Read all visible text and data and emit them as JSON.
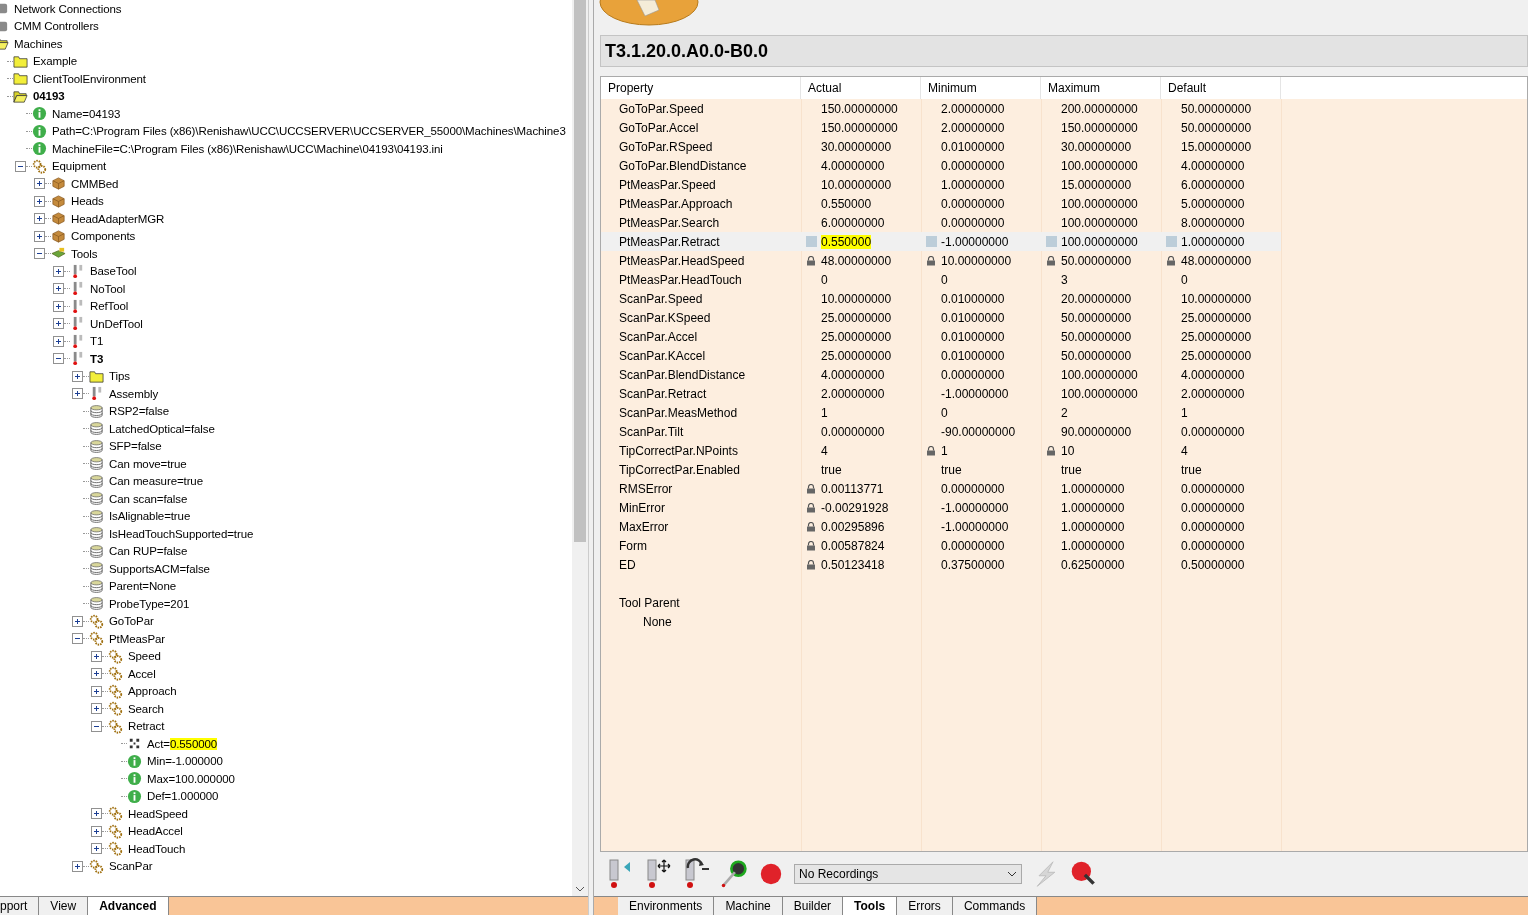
{
  "tree": [
    {
      "label": "Network Connections",
      "kind": "drive"
    },
    {
      "label": "CMM Controllers",
      "kind": "drive"
    },
    {
      "label": "Machines",
      "kind": "folder-open",
      "children": [
        {
          "label": "Example",
          "kind": "folder"
        },
        {
          "label": "ClientToolEnvironment",
          "kind": "folder"
        },
        {
          "label": "04193",
          "kind": "folder-open",
          "active": true,
          "children": [
            {
              "label": "Name=04193",
              "kind": "info"
            },
            {
              "label": "Path=C:\\Program Files (x86)\\Renishaw\\UCC\\UCCSERVER\\UCCSERVER_55000\\Machines\\Machine3",
              "kind": "info"
            },
            {
              "label": "MachineFile=C:\\Program Files (x86)\\Renishaw\\UCC\\Machine\\04193\\04193.ini",
              "kind": "info"
            },
            {
              "label": "Equipment",
              "kind": "gears",
              "expanded": true,
              "children": [
                {
                  "label": "CMMBed",
                  "kind": "box",
                  "expanded": false
                },
                {
                  "label": "Heads",
                  "kind": "box",
                  "expanded": false
                },
                {
                  "label": "HeadAdapterMGR",
                  "kind": "box",
                  "expanded": false
                },
                {
                  "label": "Components",
                  "kind": "box",
                  "expanded": false
                },
                {
                  "label": "Tools",
                  "kind": "tools",
                  "expanded": true,
                  "children": [
                    {
                      "label": "BaseTool",
                      "kind": "probe",
                      "expanded": false
                    },
                    {
                      "label": "NoTool",
                      "kind": "probe",
                      "expanded": false
                    },
                    {
                      "label": "RefTool",
                      "kind": "probe",
                      "expanded": false
                    },
                    {
                      "label": "UnDefTool",
                      "kind": "probe",
                      "expanded": false
                    },
                    {
                      "label": "T1",
                      "kind": "probe",
                      "expanded": false
                    },
                    {
                      "label": "T3",
                      "kind": "probe",
                      "expanded": true,
                      "active": true,
                      "children": [
                        {
                          "label": "Tips",
                          "kind": "folder",
                          "expanded": false
                        },
                        {
                          "label": "Assembly",
                          "kind": "probe",
                          "expanded": false
                        },
                        {
                          "label": "RSP2=false",
                          "kind": "stack"
                        },
                        {
                          "label": "LatchedOptical=false",
                          "kind": "stack"
                        },
                        {
                          "label": "SFP=false",
                          "kind": "stack"
                        },
                        {
                          "label": "Can move=true",
                          "kind": "stack"
                        },
                        {
                          "label": "Can measure=true",
                          "kind": "stack"
                        },
                        {
                          "label": "Can scan=false",
                          "kind": "stack"
                        },
                        {
                          "label": "IsAlignable=true",
                          "kind": "stack"
                        },
                        {
                          "label": "IsHeadTouchSupported=true",
                          "kind": "stack"
                        },
                        {
                          "label": "Can RUP=false",
                          "kind": "stack"
                        },
                        {
                          "label": "SupportsACM=false",
                          "kind": "stack"
                        },
                        {
                          "label": "Parent=None",
                          "kind": "stack"
                        },
                        {
                          "label": "ProbeType=201",
                          "kind": "stack"
                        },
                        {
                          "label": "GoToPar",
                          "kind": "gears",
                          "expanded": false
                        },
                        {
                          "label": "PtMeasPar",
                          "kind": "gears",
                          "expanded": true,
                          "children": [
                            {
                              "label": "Speed",
                              "kind": "gears",
                              "expanded": false
                            },
                            {
                              "label": "Accel",
                              "kind": "gears",
                              "expanded": false
                            },
                            {
                              "label": "Approach",
                              "kind": "gears",
                              "expanded": false
                            },
                            {
                              "label": "Search",
                              "kind": "gears",
                              "expanded": false
                            },
                            {
                              "label": "Retract",
                              "kind": "gears",
                              "expanded": true,
                              "children": [
                                {
                                  "label": "Act=",
                                  "value": "0.550000",
                                  "highlighted": true,
                                  "kind": "grid"
                                },
                                {
                                  "label": "Min=-1.000000",
                                  "kind": "info"
                                },
                                {
                                  "label": "Max=100.000000",
                                  "kind": "info"
                                },
                                {
                                  "label": "Def=1.000000",
                                  "kind": "info"
                                }
                              ]
                            },
                            {
                              "label": "HeadSpeed",
                              "kind": "gears",
                              "expanded": false
                            },
                            {
                              "label": "HeadAccel",
                              "kind": "gears",
                              "expanded": false
                            },
                            {
                              "label": "HeadTouch",
                              "kind": "gears",
                              "expanded": false
                            }
                          ]
                        },
                        {
                          "label": "ScanPar",
                          "kind": "gears",
                          "expanded": false
                        }
                      ]
                    }
                  ]
                }
              ]
            }
          ]
        }
      ]
    }
  ],
  "left_tabs": [
    {
      "label": "pport",
      "selected": false
    },
    {
      "label": "View",
      "selected": false
    },
    {
      "label": "Advanced",
      "selected": true
    }
  ],
  "title": "T3.1.20.0.A0.0-B0.0",
  "table": {
    "columns": [
      "Property",
      "Actual",
      "Minimum",
      "Maximum",
      "Default"
    ],
    "rows": [
      {
        "selected": false,
        "cells": [
          {
            "text": "GoToPar.Speed"
          },
          {
            "text": "150.00000000"
          },
          {
            "text": "2.00000000"
          },
          {
            "text": "200.00000000"
          },
          {
            "text": "50.00000000"
          }
        ]
      },
      {
        "selected": false,
        "cells": [
          {
            "text": "GoToPar.Accel"
          },
          {
            "text": "150.00000000"
          },
          {
            "text": "2.00000000"
          },
          {
            "text": "150.00000000"
          },
          {
            "text": "50.00000000"
          }
        ]
      },
      {
        "selected": false,
        "cells": [
          {
            "text": "GoToPar.RSpeed"
          },
          {
            "text": "30.00000000"
          },
          {
            "text": "0.01000000"
          },
          {
            "text": "30.00000000"
          },
          {
            "text": "15.00000000"
          }
        ]
      },
      {
        "selected": false,
        "cells": [
          {
            "text": "GoToPar.BlendDistance"
          },
          {
            "text": "4.00000000"
          },
          {
            "text": "0.00000000"
          },
          {
            "text": "100.00000000"
          },
          {
            "text": "4.00000000"
          }
        ]
      },
      {
        "selected": false,
        "cells": [
          {
            "text": "PtMeasPar.Speed"
          },
          {
            "text": "10.00000000"
          },
          {
            "text": "1.00000000"
          },
          {
            "text": "15.00000000"
          },
          {
            "text": "6.00000000"
          }
        ]
      },
      {
        "selected": false,
        "cells": [
          {
            "text": "PtMeasPar.Approach"
          },
          {
            "text": "0.550000"
          },
          {
            "text": "0.00000000"
          },
          {
            "text": "100.00000000"
          },
          {
            "text": "5.00000000"
          }
        ]
      },
      {
        "selected": false,
        "cells": [
          {
            "text": "PtMeasPar.Search"
          },
          {
            "text": "6.00000000"
          },
          {
            "text": "0.00000000"
          },
          {
            "text": "100.00000000"
          },
          {
            "text": "8.00000000"
          }
        ]
      },
      {
        "selected": true,
        "cells": [
          {
            "text": "PtMeasPar.Retract"
          },
          {
            "text": "0.550000",
            "kind": "square",
            "highlighted": true
          },
          {
            "text": "-1.00000000",
            "kind": "square"
          },
          {
            "text": "100.00000000",
            "kind": "square"
          },
          {
            "text": "1.00000000",
            "kind": "square"
          }
        ]
      },
      {
        "selected": false,
        "cells": [
          {
            "text": "PtMeasPar.HeadSpeed"
          },
          {
            "text": "48.00000000",
            "kind": "lock"
          },
          {
            "text": "10.00000000",
            "kind": "lock"
          },
          {
            "text": "50.00000000",
            "kind": "lock"
          },
          {
            "text": "48.00000000",
            "kind": "lock"
          }
        ]
      },
      {
        "selected": false,
        "cells": [
          {
            "text": "PtMeasPar.HeadTouch"
          },
          {
            "text": "0"
          },
          {
            "text": "0"
          },
          {
            "text": "3"
          },
          {
            "text": "0"
          }
        ]
      },
      {
        "selected": false,
        "cells": [
          {
            "text": "ScanPar.Speed"
          },
          {
            "text": "10.00000000"
          },
          {
            "text": "0.01000000"
          },
          {
            "text": "20.00000000"
          },
          {
            "text": "10.00000000"
          }
        ]
      },
      {
        "selected": false,
        "cells": [
          {
            "text": "ScanPar.KSpeed"
          },
          {
            "text": "25.00000000"
          },
          {
            "text": "0.01000000"
          },
          {
            "text": "50.00000000"
          },
          {
            "text": "25.00000000"
          }
        ]
      },
      {
        "selected": false,
        "cells": [
          {
            "text": "ScanPar.Accel"
          },
          {
            "text": "25.00000000"
          },
          {
            "text": "0.01000000"
          },
          {
            "text": "50.00000000"
          },
          {
            "text": "25.00000000"
          }
        ]
      },
      {
        "selected": false,
        "cells": [
          {
            "text": "ScanPar.KAccel"
          },
          {
            "text": "25.00000000"
          },
          {
            "text": "0.01000000"
          },
          {
            "text": "50.00000000"
          },
          {
            "text": "25.00000000"
          }
        ]
      },
      {
        "selected": false,
        "cells": [
          {
            "text": "ScanPar.BlendDistance"
          },
          {
            "text": "4.00000000"
          },
          {
            "text": "0.00000000"
          },
          {
            "text": "100.00000000"
          },
          {
            "text": "4.00000000"
          }
        ]
      },
      {
        "selected": false,
        "cells": [
          {
            "text": "ScanPar.Retract"
          },
          {
            "text": "2.00000000"
          },
          {
            "text": "-1.00000000"
          },
          {
            "text": "100.00000000"
          },
          {
            "text": "2.00000000"
          }
        ]
      },
      {
        "selected": false,
        "cells": [
          {
            "text": "ScanPar.MeasMethod"
          },
          {
            "text": "1"
          },
          {
            "text": "0"
          },
          {
            "text": "2"
          },
          {
            "text": "1"
          }
        ]
      },
      {
        "selected": false,
        "cells": [
          {
            "text": "ScanPar.Tilt"
          },
          {
            "text": "0.00000000"
          },
          {
            "text": "-90.00000000"
          },
          {
            "text": "90.00000000"
          },
          {
            "text": "0.00000000"
          }
        ]
      },
      {
        "selected": false,
        "cells": [
          {
            "text": "TipCorrectPar.NPoints"
          },
          {
            "text": "4"
          },
          {
            "text": "1",
            "kind": "lock"
          },
          {
            "text": "10",
            "kind": "lock"
          },
          {
            "text": "4"
          }
        ]
      },
      {
        "selected": false,
        "cells": [
          {
            "text": "TipCorrectPar.Enabled"
          },
          {
            "text": "true"
          },
          {
            "text": "true"
          },
          {
            "text": "true"
          },
          {
            "text": "true"
          }
        ]
      },
      {
        "selected": false,
        "cells": [
          {
            "text": "RMSError"
          },
          {
            "text": "0.00113771",
            "kind": "lock"
          },
          {
            "text": "0.00000000"
          },
          {
            "text": "1.00000000"
          },
          {
            "text": "0.00000000"
          }
        ]
      },
      {
        "selected": false,
        "cells": [
          {
            "text": "MinError"
          },
          {
            "text": "-0.00291928",
            "kind": "lock"
          },
          {
            "text": "-1.00000000"
          },
          {
            "text": "1.00000000"
          },
          {
            "text": "0.00000000"
          }
        ]
      },
      {
        "selected": false,
        "cells": [
          {
            "text": "MaxError"
          },
          {
            "text": "0.00295896",
            "kind": "lock"
          },
          {
            "text": "-1.00000000"
          },
          {
            "text": "1.00000000"
          },
          {
            "text": "0.00000000"
          }
        ]
      },
      {
        "selected": false,
        "cells": [
          {
            "text": "Form"
          },
          {
            "text": "0.00587824",
            "kind": "lock"
          },
          {
            "text": "0.00000000"
          },
          {
            "text": "1.00000000"
          },
          {
            "text": "0.00000000"
          }
        ]
      },
      {
        "selected": false,
        "cells": [
          {
            "text": "ED"
          },
          {
            "text": "0.50123418",
            "kind": "lock"
          },
          {
            "text": "0.37500000"
          },
          {
            "text": "0.62500000"
          },
          {
            "text": "0.50000000"
          }
        ]
      }
    ],
    "tool_parent": {
      "label": "Tool Parent",
      "value": "None"
    }
  },
  "recordings": {
    "value": "No Recordings"
  },
  "right_tabs": [
    {
      "label": "Environments",
      "selected": false
    },
    {
      "label": "Machine",
      "selected": false
    },
    {
      "label": "Builder",
      "selected": false
    },
    {
      "label": "Tools",
      "selected": true
    },
    {
      "label": "Errors",
      "selected": false
    },
    {
      "label": "Commands",
      "selected": false
    }
  ]
}
